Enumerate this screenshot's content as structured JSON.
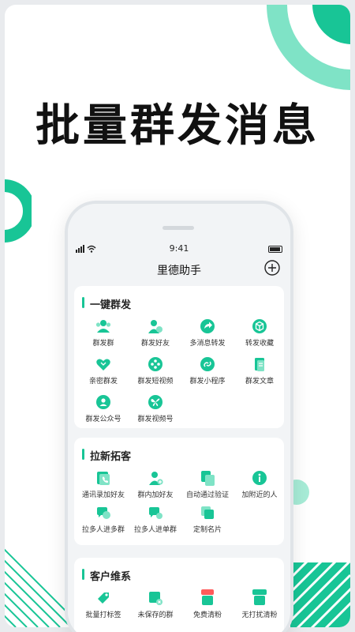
{
  "headline": "批量群发消息",
  "phone": {
    "status_time": "9:41",
    "nav_title": "里德助手",
    "sections": [
      {
        "title": "一键群发",
        "items": [
          {
            "label": "群发群",
            "icon": "group-icon"
          },
          {
            "label": "群发好友",
            "icon": "friend-icon"
          },
          {
            "label": "多消息转发",
            "icon": "forward-icon"
          },
          {
            "label": "转发收藏",
            "icon": "box-icon"
          },
          {
            "label": "亲密群发",
            "icon": "heart-icon"
          },
          {
            "label": "群发短视频",
            "icon": "film-icon"
          },
          {
            "label": "群发小程序",
            "icon": "link-icon"
          },
          {
            "label": "群发文章",
            "icon": "article-icon"
          },
          {
            "label": "群发公众号",
            "icon": "official-icon"
          },
          {
            "label": "群发视频号",
            "icon": "butterfly-icon"
          }
        ]
      },
      {
        "title": "拉新拓客",
        "items": [
          {
            "label": "通讯录加好友",
            "icon": "contacts-icon"
          },
          {
            "label": "群内加好友",
            "icon": "add-user-icon"
          },
          {
            "label": "自动通过验证",
            "icon": "verify-icon"
          },
          {
            "label": "加附近的人",
            "icon": "info-icon"
          },
          {
            "label": "拉多人进多群",
            "icon": "chat-multi-icon"
          },
          {
            "label": "拉多人进单群",
            "icon": "chat-single-icon"
          },
          {
            "label": "定制名片",
            "icon": "card-icon"
          }
        ]
      },
      {
        "title": "客户维系",
        "items": [
          {
            "label": "批量打标签",
            "icon": "tag-icon"
          },
          {
            "label": "未保存的群",
            "icon": "unsaved-icon"
          },
          {
            "label": "免费清粉",
            "icon": "free-clean-icon",
            "badge": "免费"
          },
          {
            "label": "无打扰清粉",
            "icon": "quiet-clean-icon",
            "badge": "无打扰"
          }
        ]
      }
    ]
  },
  "colors": {
    "accent": "#18c596",
    "accent_light": "#7fe3c6",
    "text": "#111111"
  }
}
